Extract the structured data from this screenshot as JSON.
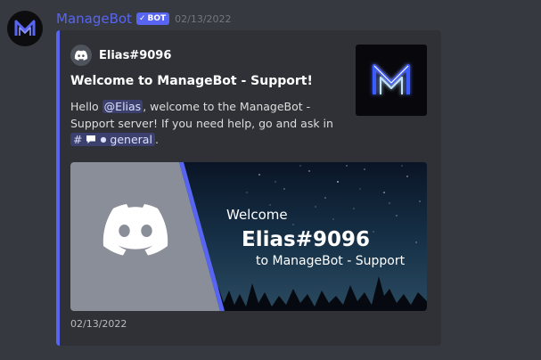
{
  "message": {
    "username": "ManageBot",
    "bot_tag": "BOT",
    "bot_tag_check": "✓",
    "timestamp": "02/13/2022"
  },
  "embed": {
    "accent_color": "#5865f2",
    "author_name": "Elias#9096",
    "title": "Welcome to ManageBot - Support!",
    "description": {
      "prefix": "Hello ",
      "user_mention": "@Elias",
      "middle": ", welcome to the ManageBot - Support server! If you need help, go and ask in ",
      "channel_prefix": "#",
      "channel_name": "general",
      "suffix": "."
    },
    "banner": {
      "welcome_line": "Welcome",
      "name_line": "Elias#9096",
      "to_line": "to ManageBot - Support"
    },
    "footer_timestamp": "02/13/2022"
  },
  "icons": {
    "avatar": "managebot-logo-icon",
    "author": "discord-logo-icon",
    "thumbnail": "managebot-neon-logo-icon",
    "channel": "text-channel-hash-icon",
    "channel_thread": "speech-bubble-icon"
  }
}
